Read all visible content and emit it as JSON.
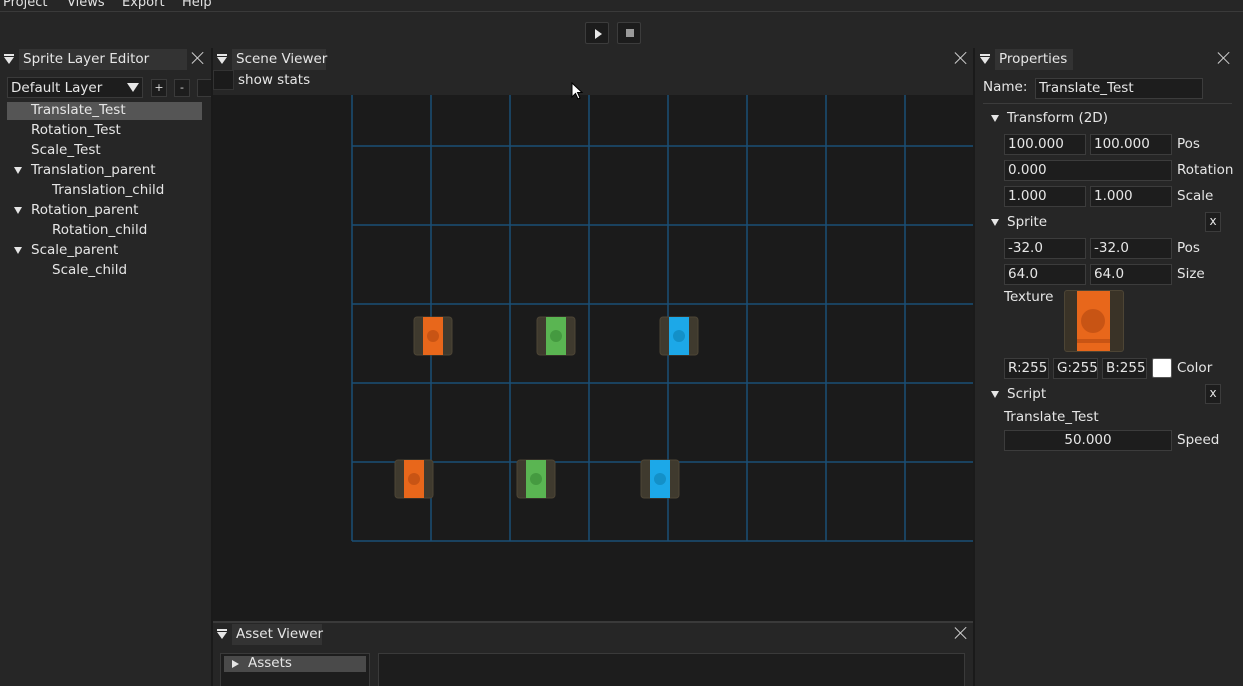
{
  "menu": {
    "items": [
      "Project",
      "Views",
      "Export",
      "Help"
    ]
  },
  "toolbar": {
    "play_icon": "play-icon",
    "stop_icon": "stop-icon"
  },
  "sprite_layer_editor": {
    "title": "Sprite Layer Editor",
    "layer_select": "Default Layer",
    "add_label": "+",
    "remove_label": "-",
    "items": [
      {
        "label": "Translate_Test",
        "selected": true
      },
      {
        "label": "Rotation_Test"
      },
      {
        "label": "Scale_Test"
      },
      {
        "label": "Translation_parent",
        "expanded": true
      },
      {
        "label": "Translation_child"
      },
      {
        "label": "Rotation_parent",
        "expanded": true
      },
      {
        "label": "Rotation_child"
      },
      {
        "label": "Scale_parent",
        "expanded": true
      },
      {
        "label": "Scale_child"
      }
    ]
  },
  "scene_viewer": {
    "title": "Scene Viewer",
    "show_stats_label": "show stats",
    "sprite_colors": {
      "orange": "#e8671b",
      "green": "#5ab552",
      "blue": "#1ca8e8"
    }
  },
  "properties": {
    "title": "Properties",
    "name_label": "Name:",
    "name_value": "Translate_Test",
    "transform": {
      "title": "Transform (2D)",
      "pos_x": "100.000",
      "pos_y": "100.000",
      "pos_label": "Pos",
      "rotation": "0.000",
      "rotation_label": "Rotation",
      "scale_x": "1.000",
      "scale_y": "1.000",
      "scale_label": "Scale"
    },
    "sprite": {
      "title": "Sprite",
      "x_label": "x",
      "pos_x": "-32.0",
      "pos_y": "-32.0",
      "pos_label": "Pos",
      "size_x": "64.0",
      "size_y": "64.0",
      "size_label": "Size",
      "texture_label": "Texture",
      "r": "R:255",
      "g": "G:255",
      "b": "B:255",
      "color_label": "Color"
    },
    "script": {
      "title": "Script",
      "x_label": "x",
      "name": "Translate_Test",
      "speed": "50.000",
      "speed_label": "Speed"
    }
  },
  "asset_viewer": {
    "title": "Asset Viewer",
    "root_label": "Assets"
  }
}
